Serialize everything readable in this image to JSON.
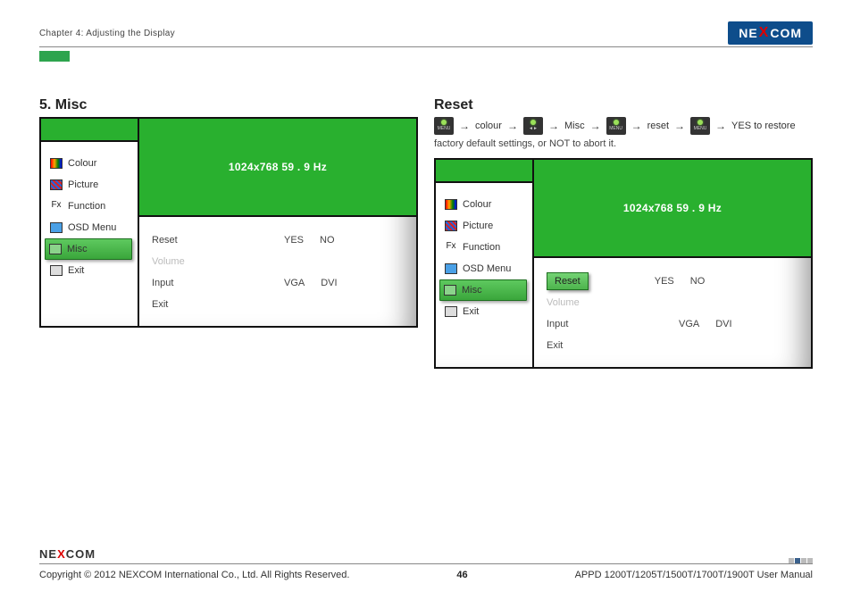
{
  "header": {
    "chapter": "Chapter 4: Adjusting the Display",
    "brand_left": "NE",
    "brand_x": "X",
    "brand_right": "COM"
  },
  "left_section": {
    "heading": "5. Misc"
  },
  "right_section": {
    "heading": "Reset"
  },
  "steps": {
    "s1": "colour",
    "s2": "Misc",
    "s3": "reset",
    "s4": "YES to restore",
    "arrow": "→",
    "menu_label": "MENU"
  },
  "reset_note": "factory default settings, or NOT to abort it.",
  "osd": {
    "resolution": "1024x768  59  . 9 Hz",
    "menu": {
      "colour": "Colour",
      "picture": "Picture",
      "function": "Function",
      "osd_menu": "OSD Menu",
      "misc": "Misc",
      "exit": "Exit"
    },
    "rows": {
      "reset": "Reset",
      "volume": "Volume",
      "input": "Input",
      "exit": "Exit",
      "yes": "YES",
      "no": "NO",
      "vga": "VGA",
      "dvi": "DVI"
    }
  },
  "footer": {
    "brand_left": "NE",
    "brand_x": "X",
    "brand_right": "COM",
    "copyright": "Copyright © 2012 NEXCOM International Co., Ltd. All Rights Reserved.",
    "page": "46",
    "doc": "APPD 1200T/1205T/1500T/1700T/1900T User Manual"
  }
}
